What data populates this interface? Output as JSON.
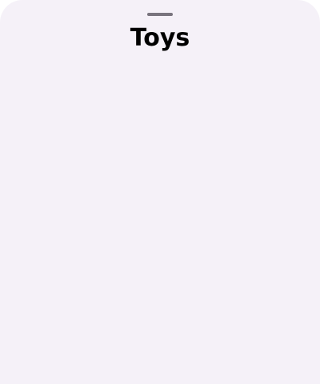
{
  "sheet": {
    "title": "Toys",
    "background_color": "#f5f1f8",
    "handle_color": "#79747e"
  }
}
